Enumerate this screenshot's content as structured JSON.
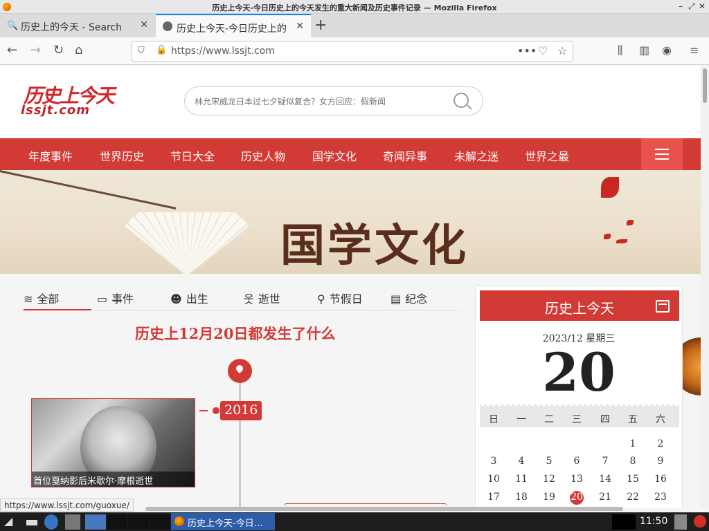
{
  "window": {
    "title": "历史上今天-今日历史上的今天发生的重大新闻及历史事件记录 — Mozilla Firefox"
  },
  "tabs": [
    {
      "label": "历史上的今天 - Search",
      "active": false
    },
    {
      "label": "历史上今天-今日历史上的今天发生的重大新闻及历史事件记录",
      "active": true
    }
  ],
  "navbar": {
    "url": "https://www.lssjt.com",
    "more_icon": "•••"
  },
  "site": {
    "logo_cn": "历史上今天",
    "logo_en": "lssjt.com",
    "search_placeholder": "林允宋威龙日本过七夕疑似复合？女方回应：假新闻",
    "menu": [
      "年度事件",
      "世界历史",
      "节日大全",
      "历史人物",
      "国学文化",
      "奇闻异事",
      "未解之迷",
      "世界之最"
    ],
    "banner_title": "国学文化",
    "filters": [
      {
        "label": "全部",
        "icon": "layers-icon",
        "active": true
      },
      {
        "label": "事件",
        "icon": "calendar-icon",
        "active": false
      },
      {
        "label": "出生",
        "icon": "baby-icon",
        "active": false
      },
      {
        "label": "逝世",
        "icon": "person-icon",
        "active": false
      },
      {
        "label": "节假日",
        "icon": "balloon-icon",
        "active": false
      },
      {
        "label": "纪念",
        "icon": "document-icon",
        "active": false
      }
    ],
    "day_title": "历史上12月20日都发生了什么",
    "event": {
      "year": "2016",
      "caption": "首位戛纳影后米歇尔·摩根逝世"
    },
    "calendar": {
      "header": "历史上今天",
      "year_month": "2023/12 星期三",
      "day": "20",
      "weekdays": [
        "日",
        "一",
        "二",
        "三",
        "四",
        "五",
        "六"
      ],
      "rows": [
        [
          "",
          "",
          "",
          "",
          "",
          "1",
          "2"
        ],
        [
          "3",
          "4",
          "5",
          "6",
          "7",
          "8",
          "9"
        ],
        [
          "10",
          "11",
          "12",
          "13",
          "14",
          "15",
          "16"
        ],
        [
          "17",
          "18",
          "19",
          "20",
          "21",
          "22",
          "23"
        ]
      ],
      "today": "20"
    }
  },
  "status_url": "https://www.lssjt.com/guoxue/",
  "taskbar": {
    "window_label": "历史上今天-今日…",
    "clock": "11:50"
  }
}
